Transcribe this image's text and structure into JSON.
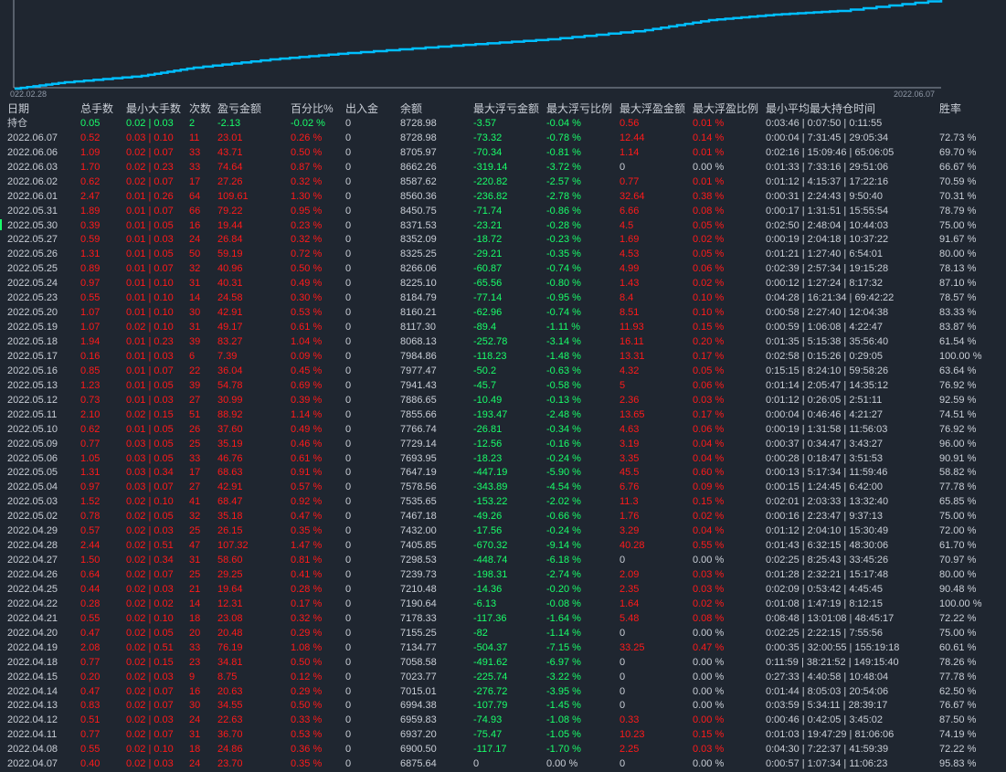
{
  "chart": {
    "x_start": "022.02.28",
    "x_end": "2022.06.07",
    "line_color": "#00bfff"
  },
  "colors": {
    "positive": "#ff1a1a",
    "negative": "#19ff6a",
    "text": "#c9ced6",
    "background": "#1f2630"
  },
  "headers": [
    "日期",
    "总手数",
    "最小大手数",
    "次数",
    "盈亏金额",
    "百分比%",
    "出入金",
    "余额",
    "最大浮亏金额",
    "最大浮亏比例",
    "最大浮盈金额",
    "最大浮盈比例",
    "最小平均最大持仓时间",
    "胜率"
  ],
  "position_row": [
    "持仓",
    "0.05",
    "0.02 | 0.03",
    "2",
    "-2.13",
    "-0.02 %",
    "0",
    "8728.98",
    "-3.57",
    "-0.04 %",
    "0.56",
    "0.01 %",
    "0:03:46 | 0:07:50 | 0:11:55",
    ""
  ],
  "rows": [
    [
      "2022.06.07",
      "0.52",
      "0.03 | 0.10",
      "11",
      "23.01",
      "0.26 %",
      "0",
      "8728.98",
      "-73.32",
      "-0.78 %",
      "12.44",
      "0.14 %",
      "0:00:04 | 7:31:45 | 29:05:34",
      "72.73 %"
    ],
    [
      "2022.06.06",
      "1.09",
      "0.02 | 0.07",
      "33",
      "43.71",
      "0.50 %",
      "0",
      "8705.97",
      "-70.34",
      "-0.81 %",
      "1.14",
      "0.01 %",
      "0:02:16 | 15:09:46 | 65:06:05",
      "69.70 %"
    ],
    [
      "2022.06.03",
      "1.70",
      "0.02 | 0.23",
      "33",
      "74.64",
      "0.87 %",
      "0",
      "8662.26",
      "-319.14",
      "-3.72 %",
      "0",
      "0.00 %",
      "0:01:33 | 7:33:16 | 29:51:06",
      "66.67 %"
    ],
    [
      "2022.06.02",
      "0.62",
      "0.02 | 0.07",
      "17",
      "27.26",
      "0.32 %",
      "0",
      "8587.62",
      "-220.82",
      "-2.57 %",
      "0.77",
      "0.01 %",
      "0:01:12 | 4:15:37 | 17:22:16",
      "70.59 %"
    ],
    [
      "2022.06.01",
      "2.47",
      "0.01 | 0.26",
      "64",
      "109.61",
      "1.30 %",
      "0",
      "8560.36",
      "-236.82",
      "-2.78 %",
      "32.64",
      "0.38 %",
      "0:00:31 | 2:24:43 | 9:50:40",
      "70.31 %"
    ],
    [
      "2022.05.31",
      "1.89",
      "0.01 | 0.07",
      "66",
      "79.22",
      "0.95 %",
      "0",
      "8450.75",
      "-71.74",
      "-0.86 %",
      "6.66",
      "0.08 %",
      "0:00:17 | 1:31:51 | 15:55:54",
      "78.79 %"
    ],
    [
      "2022.05.30",
      "0.39",
      "0.01 | 0.05",
      "16",
      "19.44",
      "0.23 %",
      "0",
      "8371.53",
      "-23.21",
      "-0.28 %",
      "4.5",
      "0.05 %",
      "0:02:50 | 2:48:04 | 10:44:03",
      "75.00 %"
    ],
    [
      "2022.05.27",
      "0.59",
      "0.01 | 0.03",
      "24",
      "26.84",
      "0.32 %",
      "0",
      "8352.09",
      "-18.72",
      "-0.23 %",
      "1.69",
      "0.02 %",
      "0:00:19 | 2:04:18 | 10:37:22",
      "91.67 %"
    ],
    [
      "2022.05.26",
      "1.31",
      "0.01 | 0.05",
      "50",
      "59.19",
      "0.72 %",
      "0",
      "8325.25",
      "-29.21",
      "-0.35 %",
      "4.53",
      "0.05 %",
      "0:01:21 | 1:27:40 | 6:54:01",
      "80.00 %"
    ],
    [
      "2022.05.25",
      "0.89",
      "0.01 | 0.07",
      "32",
      "40.96",
      "0.50 %",
      "0",
      "8266.06",
      "-60.87",
      "-0.74 %",
      "4.99",
      "0.06 %",
      "0:02:39 | 2:57:34 | 19:15:28",
      "78.13 %"
    ],
    [
      "2022.05.24",
      "0.97",
      "0.01 | 0.10",
      "31",
      "40.31",
      "0.49 %",
      "0",
      "8225.10",
      "-65.56",
      "-0.80 %",
      "1.43",
      "0.02 %",
      "0:00:12 | 1:27:24 | 8:17:32",
      "87.10 %"
    ],
    [
      "2022.05.23",
      "0.55",
      "0.01 | 0.10",
      "14",
      "24.58",
      "0.30 %",
      "0",
      "8184.79",
      "-77.14",
      "-0.95 %",
      "8.4",
      "0.10 %",
      "0:04:28 | 16:21:34 | 69:42:22",
      "78.57 %"
    ],
    [
      "2022.05.20",
      "1.07",
      "0.01 | 0.10",
      "30",
      "42.91",
      "0.53 %",
      "0",
      "8160.21",
      "-62.96",
      "-0.74 %",
      "8.51",
      "0.10 %",
      "0:00:58 | 2:27:40 | 12:04:38",
      "83.33 %"
    ],
    [
      "2022.05.19",
      "1.07",
      "0.02 | 0.10",
      "31",
      "49.17",
      "0.61 %",
      "0",
      "8117.30",
      "-89.4",
      "-1.11 %",
      "11.93",
      "0.15 %",
      "0:00:59 | 1:06:08 | 4:22:47",
      "83.87 %"
    ],
    [
      "2022.05.18",
      "1.94",
      "0.01 | 0.23",
      "39",
      "83.27",
      "1.04 %",
      "0",
      "8068.13",
      "-252.78",
      "-3.14 %",
      "16.11",
      "0.20 %",
      "0:01:35 | 5:15:38 | 35:56:40",
      "61.54 %"
    ],
    [
      "2022.05.17",
      "0.16",
      "0.01 | 0.03",
      "6",
      "7.39",
      "0.09 %",
      "0",
      "7984.86",
      "-118.23",
      "-1.48 %",
      "13.31",
      "0.17 %",
      "0:02:58 | 0:15:26 | 0:29:05",
      "100.00 %"
    ],
    [
      "2022.05.16",
      "0.85",
      "0.01 | 0.07",
      "22",
      "36.04",
      "0.45 %",
      "0",
      "7977.47",
      "-50.2",
      "-0.63 %",
      "4.32",
      "0.05 %",
      "0:15:15 | 8:24:10 | 59:58:26",
      "63.64 %"
    ],
    [
      "2022.05.13",
      "1.23",
      "0.01 | 0.05",
      "39",
      "54.78",
      "0.69 %",
      "0",
      "7941.43",
      "-45.7",
      "-0.58 %",
      "5",
      "0.06 %",
      "0:01:14 | 2:05:47 | 14:35:12",
      "76.92 %"
    ],
    [
      "2022.05.12",
      "0.73",
      "0.01 | 0.03",
      "27",
      "30.99",
      "0.39 %",
      "0",
      "7886.65",
      "-10.49",
      "-0.13 %",
      "2.36",
      "0.03 %",
      "0:01:12 | 0:26:05 | 2:51:11",
      "92.59 %"
    ],
    [
      "2022.05.11",
      "2.10",
      "0.02 | 0.15",
      "51",
      "88.92",
      "1.14 %",
      "0",
      "7855.66",
      "-193.47",
      "-2.48 %",
      "13.65",
      "0.17 %",
      "0:00:04 | 0:46:46 | 4:21:27",
      "74.51 %"
    ],
    [
      "2022.05.10",
      "0.62",
      "0.01 | 0.05",
      "26",
      "37.60",
      "0.49 %",
      "0",
      "7766.74",
      "-26.81",
      "-0.34 %",
      "4.63",
      "0.06 %",
      "0:00:19 | 1:31:58 | 11:56:03",
      "76.92 %"
    ],
    [
      "2022.05.09",
      "0.77",
      "0.03 | 0.05",
      "25",
      "35.19",
      "0.46 %",
      "0",
      "7729.14",
      "-12.56",
      "-0.16 %",
      "3.19",
      "0.04 %",
      "0:00:37 | 0:34:47 | 3:43:27",
      "96.00 %"
    ],
    [
      "2022.05.06",
      "1.05",
      "0.03 | 0.05",
      "33",
      "46.76",
      "0.61 %",
      "0",
      "7693.95",
      "-18.23",
      "-0.24 %",
      "3.35",
      "0.04 %",
      "0:00:28 | 0:18:47 | 3:51:53",
      "90.91 %"
    ],
    [
      "2022.05.05",
      "1.31",
      "0.03 | 0.34",
      "17",
      "68.63",
      "0.91 %",
      "0",
      "7647.19",
      "-447.19",
      "-5.90 %",
      "45.5",
      "0.60 %",
      "0:00:13 | 5:17:34 | 11:59:46",
      "58.82 %"
    ],
    [
      "2022.05.04",
      "0.97",
      "0.03 | 0.07",
      "27",
      "42.91",
      "0.57 %",
      "0",
      "7578.56",
      "-343.89",
      "-4.54 %",
      "6.76",
      "0.09 %",
      "0:00:15 | 1:24:45 | 6:42:00",
      "77.78 %"
    ],
    [
      "2022.05.03",
      "1.52",
      "0.02 | 0.10",
      "41",
      "68.47",
      "0.92 %",
      "0",
      "7535.65",
      "-153.22",
      "-2.02 %",
      "11.3",
      "0.15 %",
      "0:02:01 | 2:03:33 | 13:32:40",
      "65.85 %"
    ],
    [
      "2022.05.02",
      "0.78",
      "0.02 | 0.05",
      "32",
      "35.18",
      "0.47 %",
      "0",
      "7467.18",
      "-49.26",
      "-0.66 %",
      "1.76",
      "0.02 %",
      "0:00:16 | 2:23:47 | 9:37:13",
      "75.00 %"
    ],
    [
      "2022.04.29",
      "0.57",
      "0.02 | 0.03",
      "25",
      "26.15",
      "0.35 %",
      "0",
      "7432.00",
      "-17.56",
      "-0.24 %",
      "3.29",
      "0.04 %",
      "0:01:12 | 2:04:10 | 15:30:49",
      "72.00 %"
    ],
    [
      "2022.04.28",
      "2.44",
      "0.02 | 0.51",
      "47",
      "107.32",
      "1.47 %",
      "0",
      "7405.85",
      "-670.32",
      "-9.14 %",
      "40.28",
      "0.55 %",
      "0:01:43 | 6:32:15 | 48:30:06",
      "61.70 %"
    ],
    [
      "2022.04.27",
      "1.50",
      "0.02 | 0.34",
      "31",
      "58.60",
      "0.81 %",
      "0",
      "7298.53",
      "-448.74",
      "-6.18 %",
      "0",
      "0.00 %",
      "0:02:25 | 8:25:43 | 33:45:26",
      "70.97 %"
    ],
    [
      "2022.04.26",
      "0.64",
      "0.02 | 0.07",
      "25",
      "29.25",
      "0.41 %",
      "0",
      "7239.73",
      "-198.31",
      "-2.74 %",
      "2.09",
      "0.03 %",
      "0:01:28 | 2:32:21 | 15:17:48",
      "80.00 %"
    ],
    [
      "2022.04.25",
      "0.44",
      "0.02 | 0.03",
      "21",
      "19.64",
      "0.28 %",
      "0",
      "7210.48",
      "-14.36",
      "-0.20 %",
      "2.35",
      "0.03 %",
      "0:02:09 | 0:53:42 | 4:45:45",
      "90.48 %"
    ],
    [
      "2022.04.22",
      "0.28",
      "0.02 | 0.02",
      "14",
      "12.31",
      "0.17 %",
      "0",
      "7190.64",
      "-6.13",
      "-0.08 %",
      "1.64",
      "0.02 %",
      "0:01:08 | 1:47:19 | 8:12:15",
      "100.00 %"
    ],
    [
      "2022.04.21",
      "0.55",
      "0.02 | 0.10",
      "18",
      "23.08",
      "0.32 %",
      "0",
      "7178.33",
      "-117.36",
      "-1.64 %",
      "5.48",
      "0.08 %",
      "0:08:48 | 13:01:08 | 48:45:17",
      "72.22 %"
    ],
    [
      "2022.04.20",
      "0.47",
      "0.02 | 0.05",
      "20",
      "20.48",
      "0.29 %",
      "0",
      "7155.25",
      "-82",
      "-1.14 %",
      "0",
      "0.00 %",
      "0:02:25 | 2:22:15 | 7:55:56",
      "75.00 %"
    ],
    [
      "2022.04.19",
      "2.08",
      "0.02 | 0.51",
      "33",
      "76.19",
      "1.08 %",
      "0",
      "7134.77",
      "-504.37",
      "-7.15 %",
      "33.25",
      "0.47 %",
      "0:00:35 | 32:00:55 | 155:19:18",
      "60.61 %"
    ],
    [
      "2022.04.18",
      "0.77",
      "0.02 | 0.15",
      "23",
      "34.81",
      "0.50 %",
      "0",
      "7058.58",
      "-491.62",
      "-6.97 %",
      "0",
      "0.00 %",
      "0:11:59 | 38:21:52 | 149:15:40",
      "78.26 %"
    ],
    [
      "2022.04.15",
      "0.20",
      "0.02 | 0.03",
      "9",
      "8.75",
      "0.12 %",
      "0",
      "7023.77",
      "-225.74",
      "-3.22 %",
      "0",
      "0.00 %",
      "0:27:33 | 4:40:58 | 10:48:04",
      "77.78 %"
    ],
    [
      "2022.04.14",
      "0.47",
      "0.02 | 0.07",
      "16",
      "20.63",
      "0.29 %",
      "0",
      "7015.01",
      "-276.72",
      "-3.95 %",
      "0",
      "0.00 %",
      "0:01:44 | 8:05:03 | 20:54:06",
      "62.50 %"
    ],
    [
      "2022.04.13",
      "0.83",
      "0.02 | 0.07",
      "30",
      "34.55",
      "0.50 %",
      "0",
      "6994.38",
      "-107.79",
      "-1.45 %",
      "0",
      "0.00 %",
      "0:03:59 | 5:34:11 | 28:39:17",
      "76.67 %"
    ],
    [
      "2022.04.12",
      "0.51",
      "0.02 | 0.03",
      "24",
      "22.63",
      "0.33 %",
      "0",
      "6959.83",
      "-74.93",
      "-1.08 %",
      "0.33",
      "0.00 %",
      "0:00:46 | 0:42:05 | 3:45:02",
      "87.50 %"
    ],
    [
      "2022.04.11",
      "0.77",
      "0.02 | 0.07",
      "31",
      "36.70",
      "0.53 %",
      "0",
      "6937.20",
      "-75.47",
      "-1.05 %",
      "10.23",
      "0.15 %",
      "0:01:03 | 19:47:29 | 81:06:06",
      "74.19 %"
    ],
    [
      "2022.04.08",
      "0.55",
      "0.02 | 0.10",
      "18",
      "24.86",
      "0.36 %",
      "0",
      "6900.50",
      "-117.17",
      "-1.70 %",
      "2.25",
      "0.03 %",
      "0:04:30 | 7:22:37 | 41:59:39",
      "72.22 %"
    ],
    [
      "2022.04.07",
      "0.40",
      "0.02 | 0.03",
      "24",
      "23.70",
      "0.35 %",
      "0",
      "6875.64",
      "0",
      "0.00 %",
      "0",
      "0.00 %",
      "0:00:57 | 1:07:34 | 11:06:23",
      "95.83 %"
    ]
  ]
}
